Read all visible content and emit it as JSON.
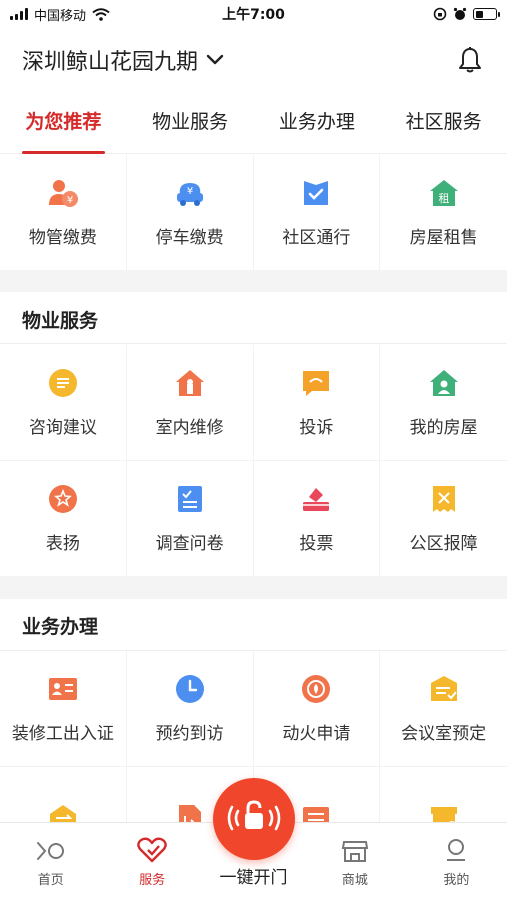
{
  "status_bar": {
    "carrier": "中国移动",
    "time": "上午7:00"
  },
  "header": {
    "community": "深圳鲸山花园九期"
  },
  "tabs": [
    {
      "label": "为您推荐",
      "active": true
    },
    {
      "label": "物业服务",
      "active": false
    },
    {
      "label": "业务办理",
      "active": false
    },
    {
      "label": "社区服务",
      "active": false
    }
  ],
  "recommended": [
    {
      "label": "物管缴费",
      "icon": "property-fee-icon",
      "color": "#f0734a"
    },
    {
      "label": "停车缴费",
      "icon": "parking-fee-icon",
      "color": "#4d8ff0"
    },
    {
      "label": "社区通行",
      "icon": "community-pass-icon",
      "color": "#4d8ff0"
    },
    {
      "label": "房屋租售",
      "icon": "house-rent-icon",
      "color": "#3fb07a"
    }
  ],
  "property_services": {
    "title": "物业服务",
    "items": [
      {
        "label": "咨询建议",
        "icon": "consult-icon",
        "color": "#f5b72b"
      },
      {
        "label": "室内维修",
        "icon": "repair-icon",
        "color": "#f0734a"
      },
      {
        "label": "投诉",
        "icon": "complaint-icon",
        "color": "#f5a22b"
      },
      {
        "label": "我的房屋",
        "icon": "my-house-icon",
        "color": "#3fb07a"
      },
      {
        "label": "表扬",
        "icon": "praise-icon",
        "color": "#f0734a"
      },
      {
        "label": "调查问卷",
        "icon": "survey-icon",
        "color": "#4d8ff0"
      },
      {
        "label": "投票",
        "icon": "vote-icon",
        "color": "#e8485a"
      },
      {
        "label": "公区报障",
        "icon": "public-fault-icon",
        "color": "#f5b72b"
      }
    ]
  },
  "business": {
    "title": "业务办理",
    "items": [
      {
        "label": "装修工出入证",
        "icon": "worker-pass-icon",
        "color": "#f0734a"
      },
      {
        "label": "预约到访",
        "icon": "appointment-icon",
        "color": "#4d8ff0"
      },
      {
        "label": "动火申请",
        "icon": "fire-apply-icon",
        "color": "#f0734a"
      },
      {
        "label": "会议室预定",
        "icon": "meeting-room-icon",
        "color": "#f5b72b"
      },
      {
        "label": "",
        "icon": "exchange-icon",
        "color": "#f5b72b"
      },
      {
        "label": "",
        "icon": "document-icon",
        "color": "#f0734a"
      },
      {
        "label": "",
        "icon": "list-icon",
        "color": "#f0734a"
      },
      {
        "label": "",
        "icon": "shop-icon",
        "color": "#f5b72b"
      }
    ]
  },
  "bottom_nav": [
    {
      "label": "首页",
      "icon": "home-icon",
      "active": false
    },
    {
      "label": "服务",
      "icon": "service-heart-icon",
      "active": true
    },
    {
      "label": "一键开门",
      "icon": "unlock-icon",
      "active": false
    },
    {
      "label": "商城",
      "icon": "mall-icon",
      "active": false
    },
    {
      "label": "我的",
      "icon": "profile-icon",
      "active": false
    }
  ],
  "colors": {
    "accent": "#d42a2a",
    "open_button": "#f0462c"
  }
}
